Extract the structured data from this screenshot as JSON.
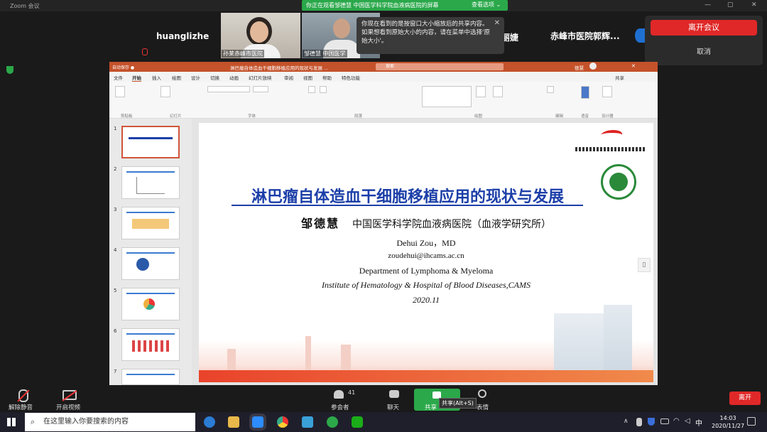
{
  "zoom": {
    "window_title": "Zoom 会议",
    "share_banner": "你正在观看邹德慧 中国医学科学院血液病医院的屏幕",
    "view_options": "查看选项 ⌄",
    "participants": [
      {
        "name": "huanglizhe"
      },
      {
        "name": "孙莱赤峰市医院"
      },
      {
        "name": "邹德慧 中国医学"
      },
      {
        "name": "丽婕"
      },
      {
        "name": "赤峰市医院郭辉..."
      }
    ],
    "tooltip": "你现在看到的是按窗口大小缩放后的共享内容。如果想看到原始大小的内容，请在菜单中选择'原始大小'。",
    "tooltip_close": "✕",
    "leave_popup": {
      "leave": "离开会议",
      "cancel": "取消"
    },
    "controls": {
      "unmute": "解除静音",
      "start_video": "开启视频",
      "participants": "参会者",
      "participant_count": "41",
      "chat": "聊天",
      "share": "共享",
      "share_tip": "共享(Alt+S)",
      "reactions": "表情",
      "leave": "离开"
    }
  },
  "ppt": {
    "title": "淋巴瘤自体造血干细胞移植应用的现状与发展 ...",
    "search_placeholder": "搜索",
    "user": "德慧",
    "share_label": "共享",
    "tabs": [
      "文件",
      "开始",
      "插入",
      "绘图",
      "设计",
      "切换",
      "动画",
      "幻灯片放映",
      "审阅",
      "视图",
      "帮助",
      "特色功能"
    ],
    "groups": [
      "剪贴板",
      "幻灯片",
      "字体",
      "段落",
      "绘图",
      "编辑",
      "语音",
      "设计器"
    ],
    "thumb_numbers": [
      "1",
      "2",
      "3",
      "4",
      "5",
      "6",
      "7"
    ],
    "slide": {
      "title": "淋巴瘤自体造血干细胞移植应用的现状与发展",
      "author_cn": "邹德慧",
      "institution_cn": "中国医学科学院血液病医院（血液学研究所）",
      "author_en": "Dehui Zou，MD",
      "email": "zoudehui@ihcams.ac.cn",
      "dept": "Department of Lymphoma & Myeloma",
      "institute": "Institute of Hematology & Hospital of Blood Diseases,CAMS",
      "date": "2020.11"
    }
  },
  "taskbar": {
    "search_placeholder": "在这里输入你要搜索的内容",
    "time": "14:03",
    "date": "2020/11/27",
    "ime": "中"
  }
}
